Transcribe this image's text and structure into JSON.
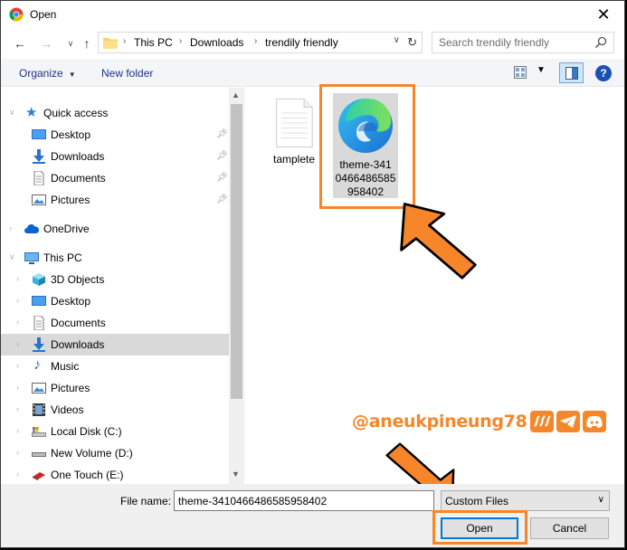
{
  "window": {
    "title": "Open",
    "close": "✕"
  },
  "address": {
    "crumbs": [
      "This PC",
      "Downloads",
      "trendily friendly"
    ],
    "search_placeholder": "Search trendily friendly"
  },
  "toolbar": {
    "organize": "Organize",
    "new_folder": "New folder",
    "help": "?"
  },
  "nav": {
    "quick_access": "Quick access",
    "qa_desktop": "Desktop",
    "qa_downloads": "Downloads",
    "qa_documents": "Documents",
    "qa_pictures": "Pictures",
    "onedrive": "OneDrive",
    "this_pc": "This PC",
    "objects3d": "3D Objects",
    "desktop": "Desktop",
    "documents": "Documents",
    "downloads": "Downloads",
    "music": "Music",
    "pictures": "Pictures",
    "videos": "Videos",
    "local_disk": "Local Disk (C:)",
    "new_volume": "New Volume (D:)",
    "one_touch": "One Touch (E:)"
  },
  "files": [
    {
      "name": "tamplete"
    },
    {
      "name": "theme-341\n0466486585\n958402"
    }
  ],
  "bottom": {
    "file_name_label": "File name:",
    "file_name_value": "theme-34104664865859584​02",
    "file_type": "Custom Files",
    "open": "Open",
    "cancel": "Cancel"
  },
  "watermark": {
    "handle": "@aneukpineung78"
  },
  "colors": {
    "highlight": "#f7862b",
    "selection": "#cce8ff",
    "accent": "#0078d7"
  }
}
